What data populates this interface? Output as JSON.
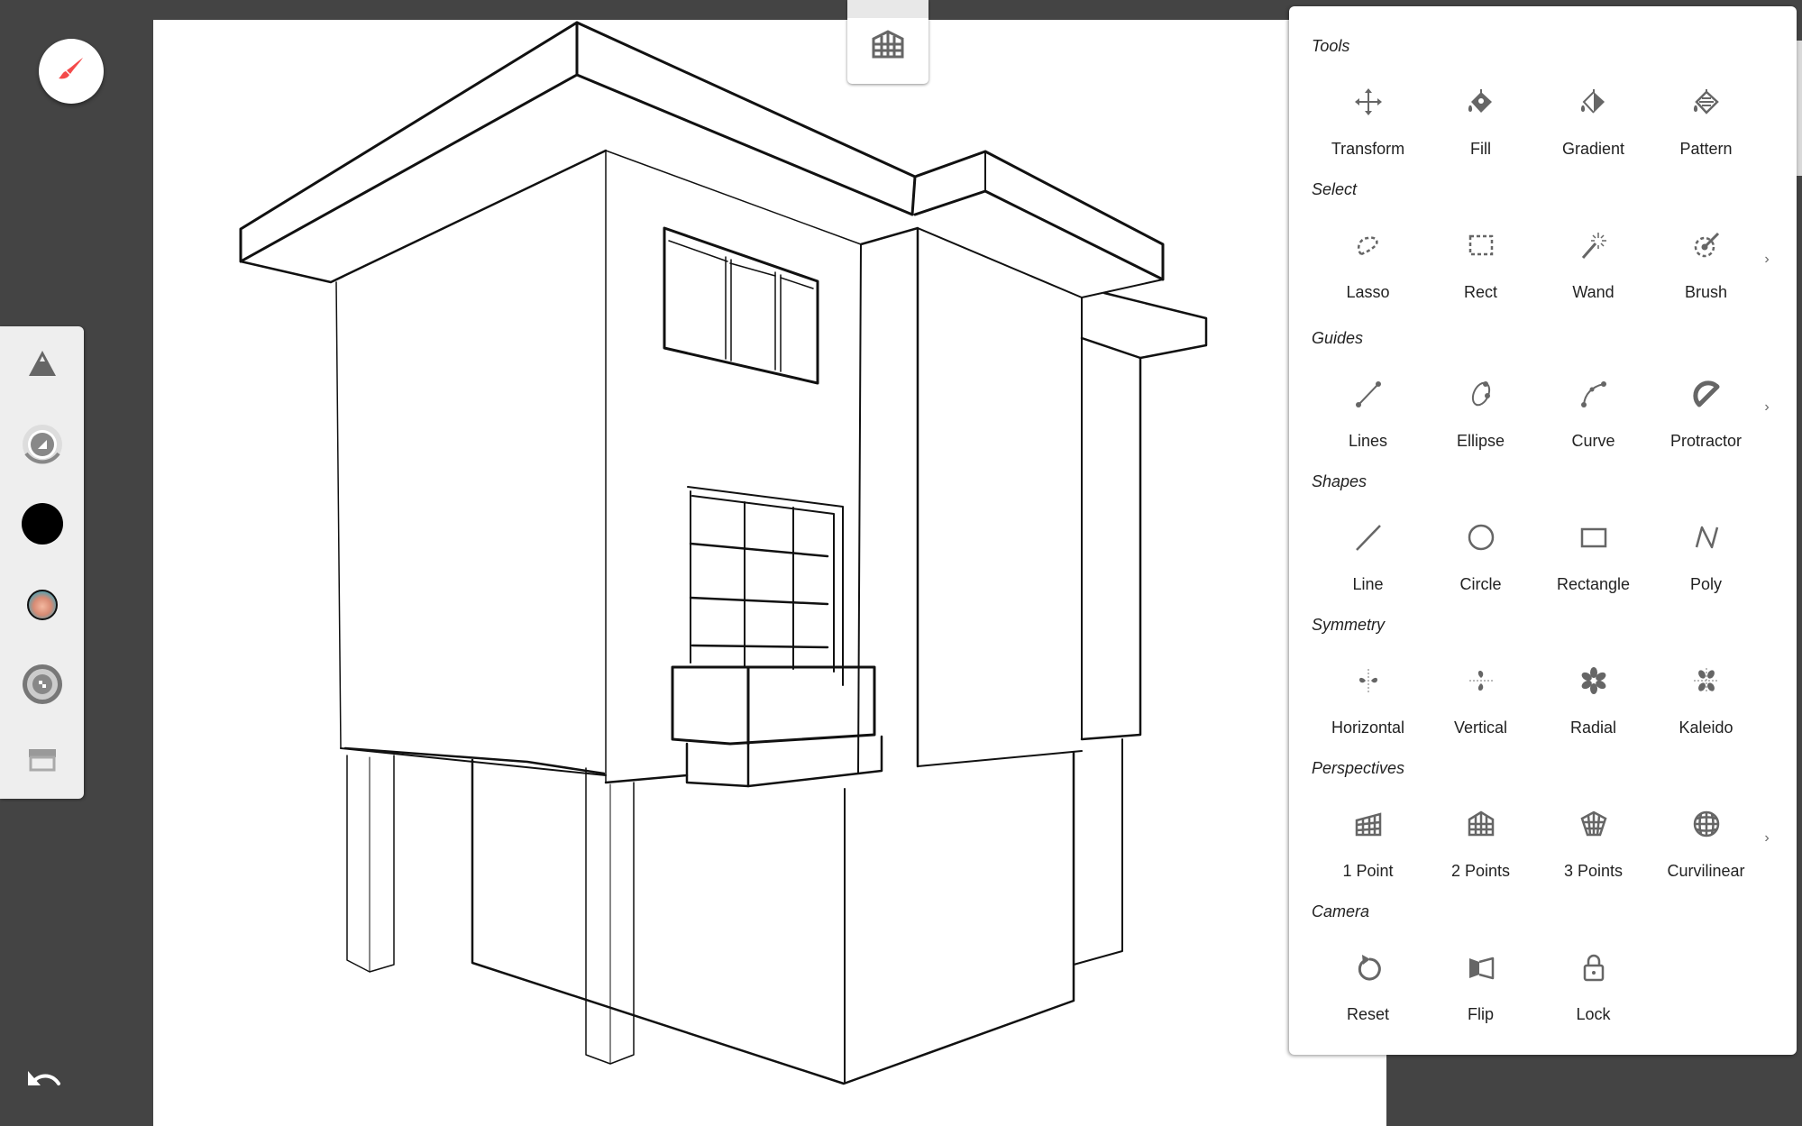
{
  "app": {
    "brand_color": "#f44a4a",
    "background_color": "#444444"
  },
  "fab": {
    "icon": "brush-icon",
    "label": "Brush"
  },
  "left_toolbar": {
    "items": [
      {
        "name": "brush-size",
        "icon": "triangle-icon"
      },
      {
        "name": "opacity",
        "icon": "opacity-dial-icon"
      },
      {
        "name": "color",
        "icon": "color-swatch-icon",
        "color": "#000000"
      },
      {
        "name": "color-picker",
        "icon": "color-wheel-icon"
      },
      {
        "name": "texture",
        "icon": "texture-dial-icon"
      },
      {
        "name": "layers",
        "icon": "layers-icon"
      }
    ]
  },
  "undo": {
    "icon": "undo-icon"
  },
  "perspective_tab": {
    "icon": "2-point-perspective-icon"
  },
  "panel": {
    "sections": [
      {
        "title": "Tools",
        "has_more": false,
        "items": [
          {
            "label": "Transform",
            "icon": "move-arrows-icon"
          },
          {
            "label": "Fill",
            "icon": "fill-bucket-icon"
          },
          {
            "label": "Gradient",
            "icon": "gradient-bucket-icon"
          },
          {
            "label": "Pattern",
            "icon": "pattern-bucket-icon"
          }
        ]
      },
      {
        "title": "Select",
        "has_more": true,
        "items": [
          {
            "label": "Lasso",
            "icon": "lasso-icon"
          },
          {
            "label": "Rect",
            "icon": "rect-select-icon"
          },
          {
            "label": "Wand",
            "icon": "magic-wand-icon"
          },
          {
            "label": "Brush",
            "icon": "brush-select-icon"
          }
        ]
      },
      {
        "title": "Guides",
        "has_more": true,
        "items": [
          {
            "label": "Lines",
            "icon": "line-guide-icon"
          },
          {
            "label": "Ellipse",
            "icon": "ellipse-guide-icon"
          },
          {
            "label": "Curve",
            "icon": "curve-guide-icon"
          },
          {
            "label": "Protractor",
            "icon": "protractor-icon"
          }
        ]
      },
      {
        "title": "Shapes",
        "has_more": false,
        "items": [
          {
            "label": "Line",
            "icon": "line-shape-icon"
          },
          {
            "label": "Circle",
            "icon": "circle-shape-icon"
          },
          {
            "label": "Rectangle",
            "icon": "rectangle-shape-icon"
          },
          {
            "label": "Poly",
            "icon": "poly-shape-icon"
          }
        ]
      },
      {
        "title": "Symmetry",
        "has_more": false,
        "items": [
          {
            "label": "Horizontal",
            "icon": "symmetry-horizontal-icon"
          },
          {
            "label": "Vertical",
            "icon": "symmetry-vertical-icon"
          },
          {
            "label": "Radial",
            "icon": "symmetry-radial-icon"
          },
          {
            "label": "Kaleido",
            "icon": "symmetry-kaleido-icon"
          }
        ]
      },
      {
        "title": "Perspectives",
        "has_more": true,
        "items": [
          {
            "label": "1 Point",
            "icon": "1-point-perspective-icon"
          },
          {
            "label": "2 Points",
            "icon": "2-point-perspective-icon"
          },
          {
            "label": "3 Points",
            "icon": "3-point-perspective-icon"
          },
          {
            "label": "Curvilinear",
            "icon": "curvilinear-perspective-icon"
          }
        ]
      },
      {
        "title": "Camera",
        "has_more": false,
        "items": [
          {
            "label": "Reset",
            "icon": "reset-rotate-icon"
          },
          {
            "label": "Flip",
            "icon": "flip-icon"
          },
          {
            "label": "Lock",
            "icon": "lock-icon"
          }
        ]
      }
    ],
    "more_glyph": "›"
  }
}
